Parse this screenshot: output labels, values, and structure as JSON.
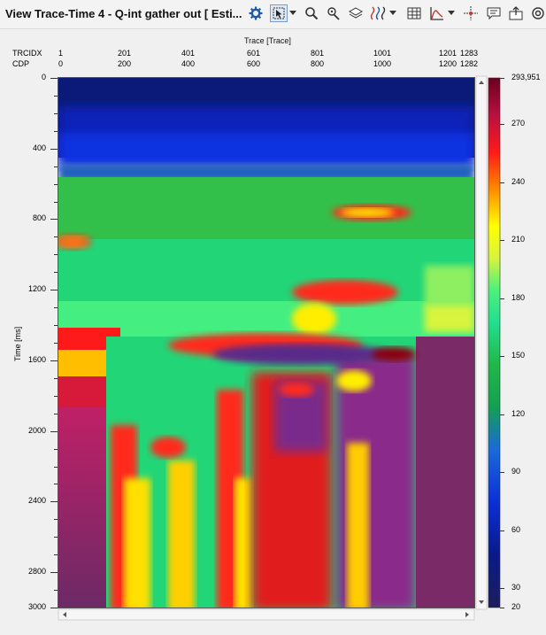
{
  "window": {
    "title": "View Trace-Time 4 - Q-int gather  out [ Esti..."
  },
  "toolbar": {
    "icons": [
      "gear-icon",
      "pointer-select-icon",
      "dropdown-arrow",
      "zoom-icon",
      "trace-pick-icon",
      "layers-icon",
      "wiggle-icon",
      "dropdown-arrow",
      "table-icon",
      "spectrum-icon",
      "dropdown-arrow",
      "crosshair-icon",
      "comment-icon",
      "export-icon",
      "settings-more-icon"
    ]
  },
  "header_axis": {
    "title": "Trace [Trace]",
    "rows": [
      {
        "name": "TRCIDX",
        "values": [
          "1",
          "201",
          "401",
          "601",
          "801",
          "1001",
          "1201",
          "1283"
        ]
      },
      {
        "name": "CDP",
        "values": [
          "0",
          "200",
          "400",
          "600",
          "800",
          "1000",
          "1200",
          "1282"
        ]
      }
    ]
  },
  "y_axis": {
    "label": "Time [ms]",
    "ticks": [
      "0",
      "400",
      "800",
      "1200",
      "1600",
      "2000",
      "2400",
      "2800",
      "3000"
    ],
    "range": [
      0,
      3000
    ]
  },
  "colorbar": {
    "ticks": [
      "293,951",
      "270",
      "240",
      "210",
      "180",
      "150",
      "120",
      "90",
      "60",
      "30",
      "20"
    ],
    "range": [
      20,
      293.951
    ]
  },
  "colors": {
    "panel_bg": "#f0f0f0",
    "axis": "#333333"
  }
}
